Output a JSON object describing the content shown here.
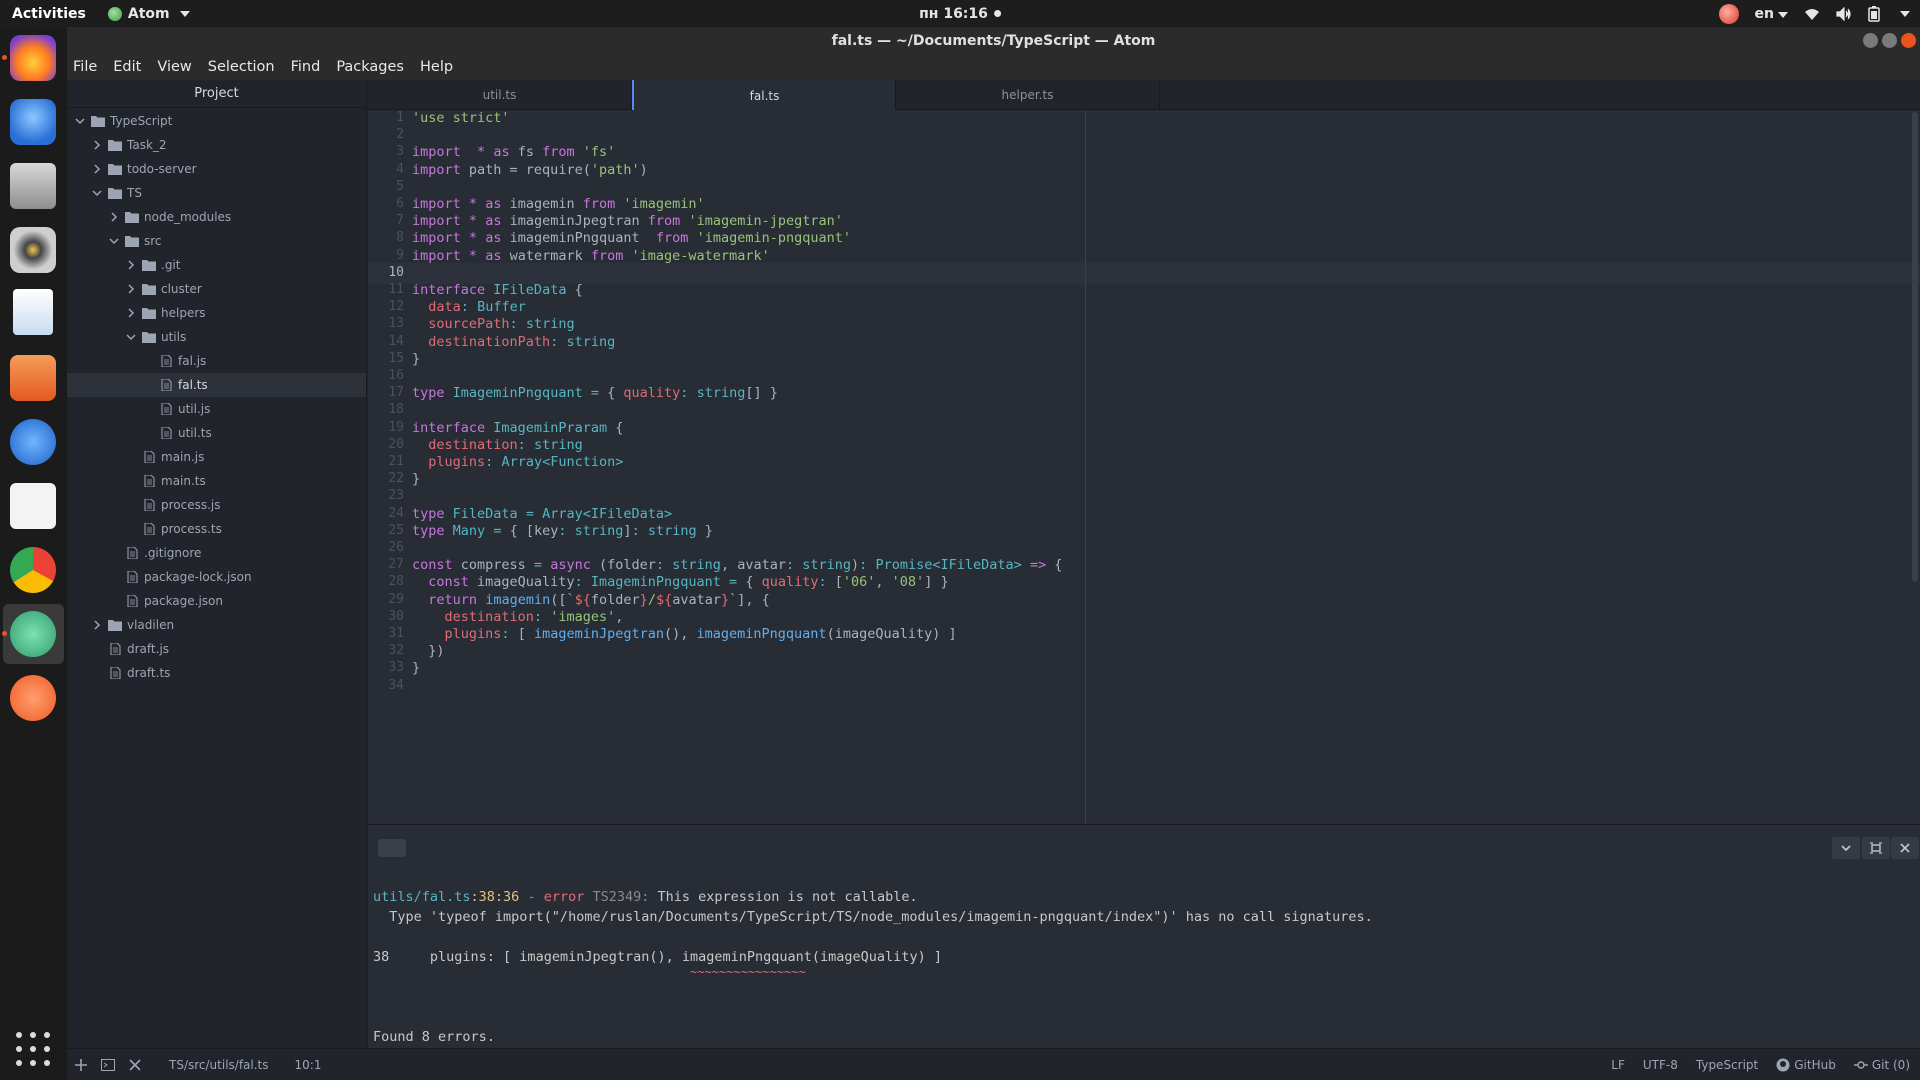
{
  "topbar": {
    "activities": "Activities",
    "app_name": "Atom",
    "clock": "пн 16:16",
    "language": "en"
  },
  "window": {
    "title": "fal.ts — ~/Documents/TypeScript — Atom"
  },
  "menu": [
    "File",
    "Edit",
    "View",
    "Selection",
    "Find",
    "Packages",
    "Help"
  ],
  "dock": {
    "apps": [
      "firefox-icon",
      "thunderbird-icon",
      "files-icon",
      "rhythmbox-icon",
      "libreoffice-writer-icon",
      "software-center-icon",
      "help-icon",
      "amazon-icon",
      "chrome-icon",
      "atom-icon",
      "postman-icon"
    ]
  },
  "tree": {
    "header": "Project",
    "rows": [
      {
        "label": "TypeScript",
        "kind": "folder",
        "depth": 0,
        "open": true
      },
      {
        "label": "Task_2",
        "kind": "folder",
        "depth": 1,
        "open": false
      },
      {
        "label": "todo-server",
        "kind": "folder",
        "depth": 1,
        "open": false
      },
      {
        "label": "TS",
        "kind": "folder",
        "depth": 1,
        "open": true
      },
      {
        "label": "node_modules",
        "kind": "folder",
        "depth": 2,
        "open": false
      },
      {
        "label": "src",
        "kind": "folder",
        "depth": 2,
        "open": true
      },
      {
        "label": ".git",
        "kind": "folder",
        "depth": 3,
        "open": false
      },
      {
        "label": "cluster",
        "kind": "folder",
        "depth": 3,
        "open": false
      },
      {
        "label": "helpers",
        "kind": "folder",
        "depth": 3,
        "open": false
      },
      {
        "label": "utils",
        "kind": "folder",
        "depth": 3,
        "open": true
      },
      {
        "label": "fal.js",
        "kind": "file",
        "depth": 4
      },
      {
        "label": "fal.ts",
        "kind": "file",
        "depth": 4,
        "selected": true
      },
      {
        "label": "util.js",
        "kind": "file",
        "depth": 4
      },
      {
        "label": "util.ts",
        "kind": "file",
        "depth": 4
      },
      {
        "label": "main.js",
        "kind": "file",
        "depth": 3
      },
      {
        "label": "main.ts",
        "kind": "file",
        "depth": 3
      },
      {
        "label": "process.js",
        "kind": "file",
        "depth": 3
      },
      {
        "label": "process.ts",
        "kind": "file",
        "depth": 3
      },
      {
        "label": ".gitignore",
        "kind": "file",
        "depth": 2
      },
      {
        "label": "package-lock.json",
        "kind": "file",
        "depth": 2
      },
      {
        "label": "package.json",
        "kind": "file",
        "depth": 2
      },
      {
        "label": "vladilen",
        "kind": "folder",
        "depth": 1,
        "open": false
      },
      {
        "label": "draft.js",
        "kind": "file",
        "depth": 1
      },
      {
        "label": "draft.ts",
        "kind": "file",
        "depth": 1
      }
    ]
  },
  "tabs": [
    {
      "label": "util.ts",
      "active": false
    },
    {
      "label": "fal.ts",
      "active": true
    },
    {
      "label": "helper.ts",
      "active": false
    }
  ],
  "editor": {
    "current_line": 10,
    "lines": [
      [
        [
          "s",
          "'use strict'"
        ]
      ],
      [],
      [
        [
          "k",
          "import"
        ],
        [
          "",
          "  "
        ],
        [
          "k",
          "*"
        ],
        [
          "",
          " "
        ],
        [
          "k",
          "as"
        ],
        [
          "",
          " fs "
        ],
        [
          "k",
          "from"
        ],
        [
          "",
          " "
        ],
        [
          "s",
          "'fs'"
        ]
      ],
      [
        [
          "k",
          "import"
        ],
        [
          "",
          " path = require("
        ],
        [
          "s",
          "'path'"
        ],
        [
          "",
          ")"
        ]
      ],
      [],
      [
        [
          "k",
          "import"
        ],
        [
          "",
          " "
        ],
        [
          "k",
          "*"
        ],
        [
          "",
          " "
        ],
        [
          "k",
          "as"
        ],
        [
          "",
          " imagemin "
        ],
        [
          "k",
          "from"
        ],
        [
          "",
          " "
        ],
        [
          "s",
          "'imagemin'"
        ]
      ],
      [
        [
          "k",
          "import"
        ],
        [
          "",
          " "
        ],
        [
          "k",
          "*"
        ],
        [
          "",
          " "
        ],
        [
          "k",
          "as"
        ],
        [
          "",
          " imageminJpegtran "
        ],
        [
          "k",
          "from"
        ],
        [
          "",
          " "
        ],
        [
          "s",
          "'imagemin-jpegtran'"
        ]
      ],
      [
        [
          "k",
          "import"
        ],
        [
          "",
          " "
        ],
        [
          "k",
          "*"
        ],
        [
          "",
          " "
        ],
        [
          "k",
          "as"
        ],
        [
          "",
          " imageminPngquant  "
        ],
        [
          "k",
          "from"
        ],
        [
          "",
          " "
        ],
        [
          "s",
          "'imagemin-pngquant'"
        ]
      ],
      [
        [
          "k",
          "import"
        ],
        [
          "",
          " "
        ],
        [
          "k",
          "*"
        ],
        [
          "",
          " "
        ],
        [
          "k",
          "as"
        ],
        [
          "",
          " watermark "
        ],
        [
          "k",
          "from"
        ],
        [
          "",
          " "
        ],
        [
          "s",
          "'image-watermark'"
        ]
      ],
      [],
      [
        [
          "k",
          "interface"
        ],
        [
          "",
          " "
        ],
        [
          "t",
          "IFileData"
        ],
        [
          "",
          " {"
        ]
      ],
      [
        [
          "",
          "  "
        ],
        [
          "p",
          "data"
        ],
        [
          "o",
          ":"
        ],
        [
          "",
          " "
        ],
        [
          "t",
          "Buffer"
        ]
      ],
      [
        [
          "",
          "  "
        ],
        [
          "p",
          "sourcePath"
        ],
        [
          "o",
          ":"
        ],
        [
          "",
          " "
        ],
        [
          "t",
          "string"
        ]
      ],
      [
        [
          "",
          "  "
        ],
        [
          "p",
          "destinationPath"
        ],
        [
          "o",
          ":"
        ],
        [
          "",
          " "
        ],
        [
          "t",
          "string"
        ]
      ],
      [
        [
          "",
          "}"
        ]
      ],
      [],
      [
        [
          "k",
          "type"
        ],
        [
          "",
          " "
        ],
        [
          "t",
          "ImageminPngquant"
        ],
        [
          "",
          " "
        ],
        [
          "o",
          "="
        ],
        [
          "",
          " { "
        ],
        [
          "p",
          "quality"
        ],
        [
          "o",
          ":"
        ],
        [
          "",
          " "
        ],
        [
          "t",
          "string"
        ],
        [
          "",
          "[] }"
        ]
      ],
      [],
      [
        [
          "k",
          "interface"
        ],
        [
          "",
          " "
        ],
        [
          "t",
          "ImageminPraram"
        ],
        [
          "",
          " {"
        ]
      ],
      [
        [
          "",
          "  "
        ],
        [
          "p",
          "destination"
        ],
        [
          "o",
          ":"
        ],
        [
          "",
          " "
        ],
        [
          "t",
          "string"
        ]
      ],
      [
        [
          "",
          "  "
        ],
        [
          "p",
          "plugins"
        ],
        [
          "o",
          ":"
        ],
        [
          "",
          " "
        ],
        [
          "t",
          "Array<Function>"
        ]
      ],
      [
        [
          "",
          "}"
        ]
      ],
      [],
      [
        [
          "k",
          "type"
        ],
        [
          "",
          " "
        ],
        [
          "t",
          "FileData"
        ],
        [
          "",
          " "
        ],
        [
          "o",
          "="
        ],
        [
          "",
          " "
        ],
        [
          "t",
          "Array<IFileData>"
        ]
      ],
      [
        [
          "k",
          "type"
        ],
        [
          "",
          " "
        ],
        [
          "t",
          "Many"
        ],
        [
          "",
          " "
        ],
        [
          "o",
          "="
        ],
        [
          "",
          " { [key"
        ],
        [
          "o",
          ":"
        ],
        [
          "",
          " "
        ],
        [
          "t",
          "string"
        ],
        [
          "",
          "]"
        ],
        [
          "o",
          ":"
        ],
        [
          "",
          " "
        ],
        [
          "t",
          "string"
        ],
        [
          "",
          " }"
        ]
      ],
      [],
      [
        [
          "k",
          "const"
        ],
        [
          "",
          " compress "
        ],
        [
          "o",
          "="
        ],
        [
          "",
          " "
        ],
        [
          "k",
          "async"
        ],
        [
          "",
          " (folder"
        ],
        [
          "o",
          ":"
        ],
        [
          "",
          " "
        ],
        [
          "t",
          "string"
        ],
        [
          "",
          ", avatar"
        ],
        [
          "o",
          ":"
        ],
        [
          "",
          " "
        ],
        [
          "t",
          "string"
        ],
        [
          "",
          ")"
        ],
        [
          "o",
          ":"
        ],
        [
          "",
          " "
        ],
        [
          "t",
          "Promise<IFileData>"
        ],
        [
          "",
          " "
        ],
        [
          "k",
          "=>"
        ],
        [
          "",
          " {"
        ]
      ],
      [
        [
          "",
          "  "
        ],
        [
          "k",
          "const"
        ],
        [
          "",
          " imageQuality"
        ],
        [
          "o",
          ":"
        ],
        [
          "",
          " "
        ],
        [
          "t",
          "ImageminPngquant"
        ],
        [
          "",
          " "
        ],
        [
          "o",
          "="
        ],
        [
          "",
          " { "
        ],
        [
          "p",
          "quality"
        ],
        [
          "o",
          ":"
        ],
        [
          "",
          " ["
        ],
        [
          "s",
          "'06'"
        ],
        [
          "",
          ", "
        ],
        [
          "s",
          "'08'"
        ],
        [
          "",
          "] }"
        ]
      ],
      [
        [
          "",
          "  "
        ],
        [
          "k",
          "return"
        ],
        [
          "",
          " "
        ],
        [
          "f",
          "imagemin"
        ],
        [
          "",
          "(["
        ],
        [
          "s",
          "`"
        ],
        [
          "p",
          "${"
        ],
        [
          "",
          "folder"
        ],
        [
          "p",
          "}"
        ],
        [
          "s",
          "/"
        ],
        [
          "p",
          "${"
        ],
        [
          "",
          "avatar"
        ],
        [
          "p",
          "}"
        ],
        [
          "s",
          "`"
        ],
        [
          "",
          "], {"
        ]
      ],
      [
        [
          "",
          "    "
        ],
        [
          "p",
          "destination"
        ],
        [
          "o",
          ":"
        ],
        [
          "",
          " "
        ],
        [
          "s",
          "'images'"
        ],
        [
          "",
          ","
        ]
      ],
      [
        [
          "",
          "    "
        ],
        [
          "p",
          "plugins"
        ],
        [
          "o",
          ":"
        ],
        [
          "",
          " [ "
        ],
        [
          "f",
          "imageminJpegtran"
        ],
        [
          "",
          "(), "
        ],
        [
          "f",
          "imageminPngquant"
        ],
        [
          "",
          "(imageQuality) ]"
        ]
      ],
      [
        [
          "",
          "  })"
        ]
      ],
      [
        [
          "",
          "}"
        ]
      ],
      []
    ]
  },
  "terminal": {
    "error_file": "utils/fal.ts",
    "error_pos": ":38:36",
    "error_sep": " - ",
    "error_word": "error",
    "error_code": " TS2349:",
    "error_msg": " This expression is not callable.",
    "detail": "  Type 'typeof import(\"/home/ruslan/Documents/TypeScript/TS/node_modules/imagemin-pngquant/index\")' has no call signatures.",
    "code_line_no": "38",
    "code_line": "     plugins: [ imageminJpegtran(), imageminPngquant(imageQuality) ]",
    "squiggle": "~~~~~~~~~~~~~~~~",
    "summary": "Found 8 errors."
  },
  "status": {
    "path": "TS/src/utils/fal.ts",
    "cursor": "10:1",
    "line_ending": "LF",
    "encoding": "UTF-8",
    "grammar": "TypeScript",
    "github": "GitHub",
    "git": "Git (0)"
  }
}
